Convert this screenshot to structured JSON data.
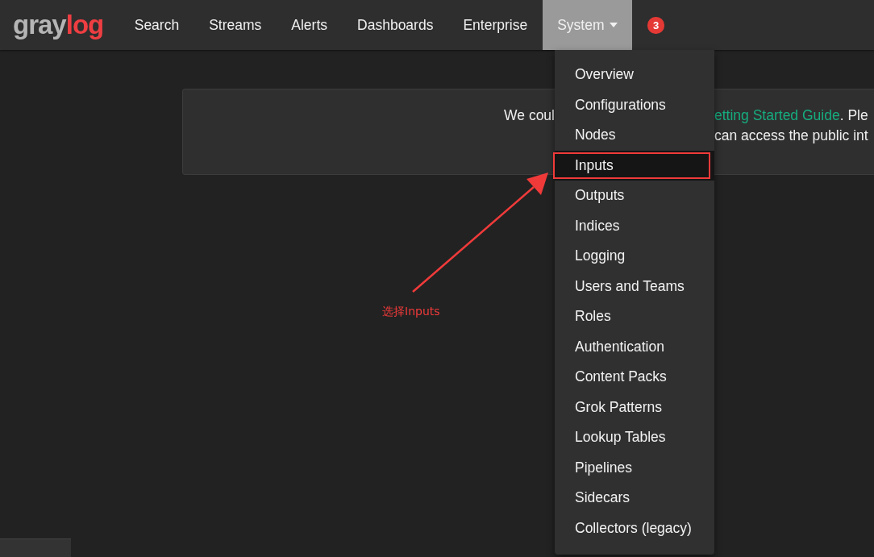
{
  "navbar": {
    "logo": {
      "part_1": "gray",
      "part_2": "log"
    },
    "items": [
      {
        "label": "Search",
        "kind": "link",
        "selected": false
      },
      {
        "label": "Streams",
        "kind": "link",
        "selected": false
      },
      {
        "label": "Alerts",
        "kind": "link",
        "selected": false
      },
      {
        "label": "Dashboards",
        "kind": "link",
        "selected": false
      },
      {
        "label": "Enterprise",
        "kind": "link",
        "selected": false
      },
      {
        "label": "System",
        "kind": "menu",
        "selected": true
      }
    ],
    "badge": "3"
  },
  "notice": {
    "line_1_start": "We coul",
    "link": "etting Started Guide",
    "line_1_end": ". Ple",
    "line_2": "can access the public int"
  },
  "dropdown": {
    "items": [
      {
        "label": "Overview",
        "selected": false
      },
      {
        "label": "Configurations",
        "selected": false
      },
      {
        "label": "Nodes",
        "selected": false
      },
      {
        "label": "Inputs",
        "selected": true
      },
      {
        "label": "Outputs",
        "selected": false
      },
      {
        "label": "Indices",
        "selected": false
      },
      {
        "label": "Logging",
        "selected": false
      },
      {
        "label": "Users and Teams",
        "selected": false
      },
      {
        "label": "Roles",
        "selected": false
      },
      {
        "label": "Authentication",
        "selected": false
      },
      {
        "label": "Content Packs",
        "selected": false
      },
      {
        "label": "Grok Patterns",
        "selected": false
      },
      {
        "label": "Lookup Tables",
        "selected": false
      },
      {
        "label": "Pipelines",
        "selected": false
      },
      {
        "label": "Sidecars",
        "selected": false
      },
      {
        "label": "Collectors (legacy)",
        "selected": false
      }
    ]
  },
  "annotation": {
    "text": "选择Inputs"
  }
}
